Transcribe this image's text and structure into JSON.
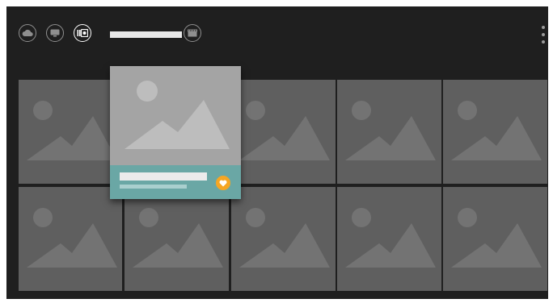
{
  "header": {
    "tabs": [
      {
        "id": "cloud",
        "icon": "cloud-icon",
        "active": false
      },
      {
        "id": "cast",
        "icon": "cast-icon",
        "active": false
      },
      {
        "id": "library",
        "icon": "photo-library-icon",
        "active": true
      },
      {
        "id": "movies",
        "icon": "clapperboard-icon",
        "active": false
      }
    ],
    "title": "",
    "menu_icon": "more-vertical-icon"
  },
  "grid": {
    "tile_icon": "image-placeholder-icon",
    "rows": 2,
    "columns": 5
  },
  "focused_card": {
    "row": 1,
    "column": 2,
    "title": "",
    "subtitle": "",
    "badge_icon": "heart-icon",
    "badge_color": "#f5a623",
    "footer_color": "#6aa7a5"
  },
  "colors": {
    "screen_background": "#1f1f1f",
    "tile_background": "#5f5f5f",
    "placeholder_art": "#737373",
    "focused_thumb": "#a4a4a4"
  }
}
